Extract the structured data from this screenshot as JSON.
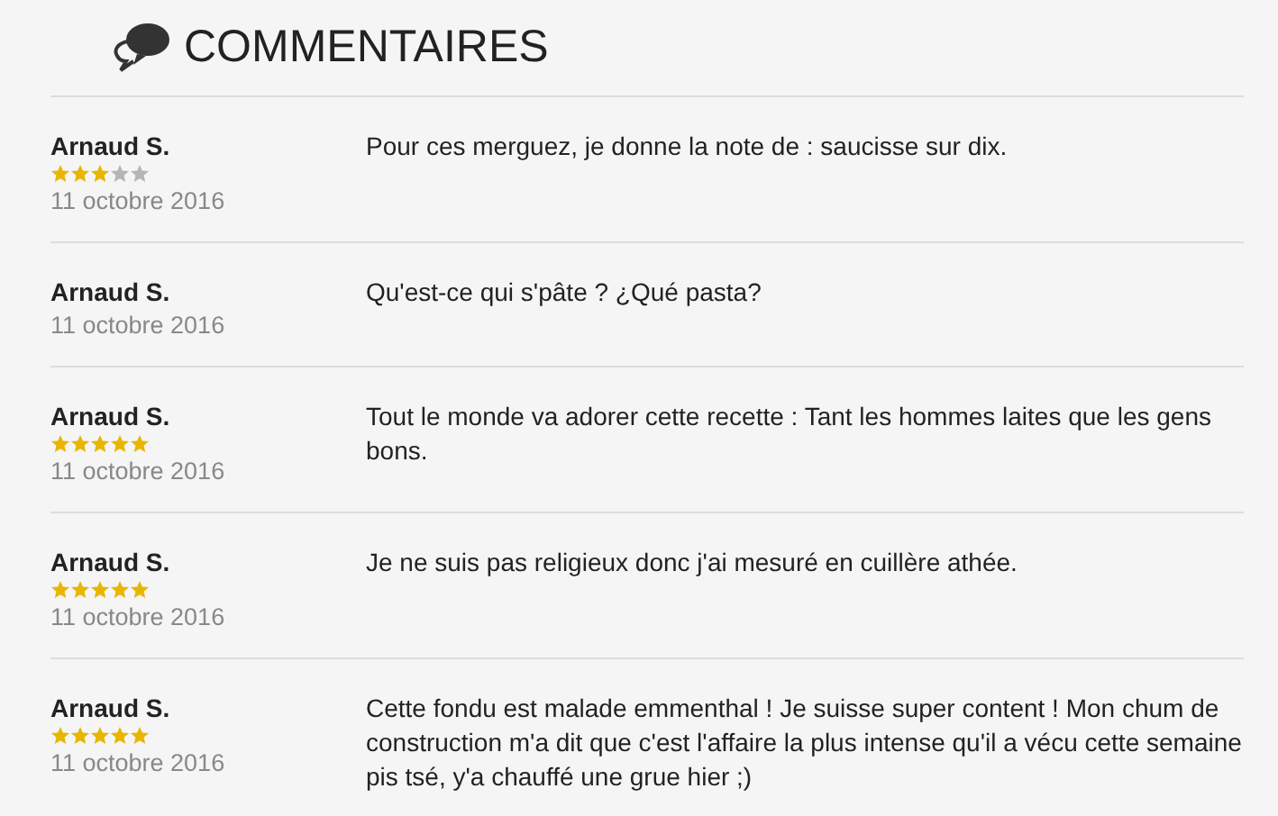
{
  "heading": "COMMENTAIRES",
  "comments": [
    {
      "author": "Arnaud S.",
      "stars": 3,
      "date": "11 octobre 2016",
      "text": "Pour ces merguez, je donne la note de : saucisse sur dix."
    },
    {
      "author": "Arnaud S.",
      "date": "11 octobre 2016",
      "text": "Qu'est-ce qui s'pâte ? ¿Qué pasta?"
    },
    {
      "author": "Arnaud S.",
      "stars": 5,
      "date": "11 octobre 2016",
      "text": "Tout le monde va adorer cette recette : Tant les hommes laites que les gens bons."
    },
    {
      "author": "Arnaud S.",
      "stars": 5,
      "date": "11 octobre 2016",
      "text": "Je ne suis pas religieux donc j'ai mesuré en cuillère athée."
    },
    {
      "author": "Arnaud S.",
      "stars": 5,
      "date": "11 octobre 2016",
      "text": "Cette fondu est malade emmenthal ! Je suisse super content ! Mon chum de construction m'a dit que c'est l'affaire la plus intense qu'il a vécu cette semaine pis tsé, y'a chauffé une grue hier ;)"
    }
  ]
}
